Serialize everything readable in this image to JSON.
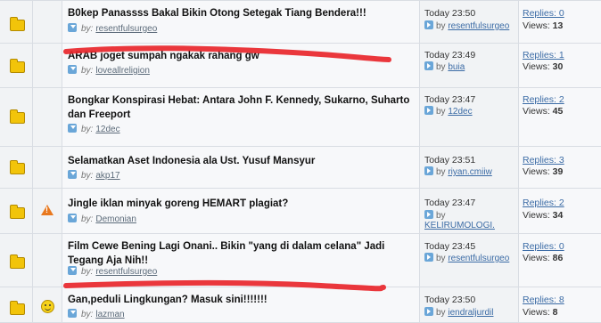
{
  "threads": [
    {
      "icon": "folder-icon",
      "prefix": "",
      "title": "B0kep Panassss Bakal Bikin Otong Setegak Tiang Bendera!!!",
      "by_label": "by:",
      "author": "resentfulsurgeo",
      "last_time": "Today 23:50",
      "last_by_label": "by",
      "last_author": "resentfulsurgeo",
      "replies": "Replies: 0",
      "views_label": "Views:",
      "views": "13"
    },
    {
      "icon": "folder-icon",
      "prefix": "",
      "title": "ARAB joget sumpah ngakak rahang gw",
      "by_label": "by:",
      "author": "loveallreligion",
      "last_time": "Today 23:49",
      "last_by_label": "by",
      "last_author": "buia",
      "replies": "Replies: 1",
      "views_label": "Views:",
      "views": "30"
    },
    {
      "icon": "folder-icon",
      "prefix": "",
      "title": "Bongkar Konspirasi Hebat: Antara John F. Kennedy, Sukarno, Suharto dan Freeport",
      "by_label": "by:",
      "author": "12dec",
      "last_time": "Today 23:47",
      "last_by_label": "by",
      "last_author": "12dec",
      "replies": "Replies: 2",
      "views_label": "Views:",
      "views": "45"
    },
    {
      "icon": "folder-icon",
      "prefix": "",
      "title": "Selamatkan Aset Indonesia ala Ust. Yusuf Mansyur",
      "by_label": "by:",
      "author": "akp17",
      "last_time": "Today 23:51",
      "last_by_label": "by",
      "last_author": "riyan.cmiiw",
      "replies": "Replies: 3",
      "views_label": "Views:",
      "views": "39"
    },
    {
      "icon": "folder-icon",
      "prefix": "warning-icon",
      "title": "Jingle iklan minyak goreng HEMART plagiat?",
      "by_label": "by:",
      "author": "Demonian",
      "last_time": "Today 23:47",
      "last_by_label": "by",
      "last_author": "KELIRUMOLOGI.",
      "replies": "Replies: 2",
      "views_label": "Views:",
      "views": "34"
    },
    {
      "icon": "folder-icon",
      "prefix": "",
      "title": "Film Cewe Bening Lagi Onani.. Bikin \"yang di dalam celana\" Jadi Tegang Aja Nih!!",
      "by_label": "by:",
      "author": "resentfulsurgeo",
      "last_time": "Today 23:45",
      "last_by_label": "by",
      "last_author": "resentfulsurgeo",
      "replies": "Replies: 0",
      "views_label": "Views:",
      "views": "86"
    },
    {
      "icon": "folder-icon",
      "prefix": "smile-icon",
      "title": "Gan,peduli Lingkungan? Masuk sini!!!!!!!",
      "by_label": "by:",
      "author": "lazman",
      "last_time": "Today 23:50",
      "last_by_label": "by",
      "last_author": "iendraljurdil",
      "replies": "Replies: 8",
      "views_label": "Views:",
      "views": "8"
    }
  ],
  "warning_glyph": "!",
  "accent_link": "#3b6ba5",
  "highlight_marker": "#e8262b"
}
